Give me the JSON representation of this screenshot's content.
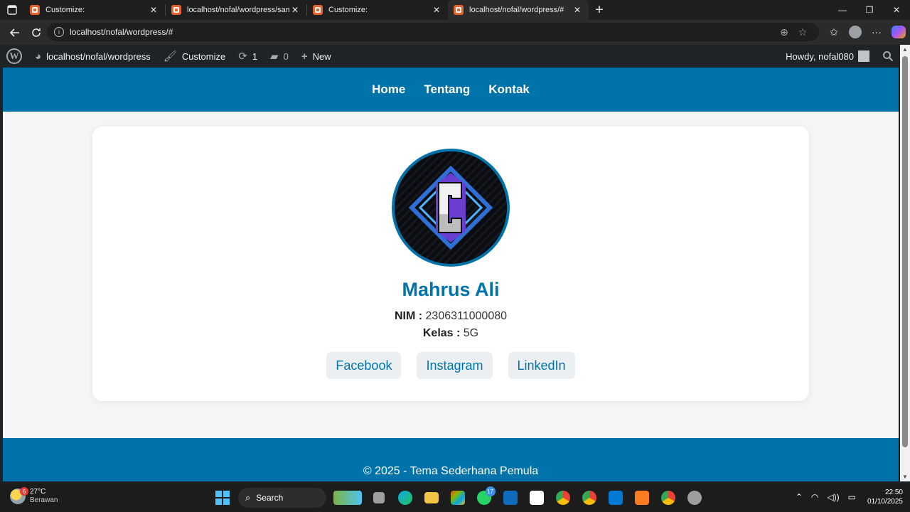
{
  "browser": {
    "tabs": [
      {
        "title": "Customize:",
        "active": false
      },
      {
        "title": "localhost/nofal/wordpress/sample-page/",
        "active": false
      },
      {
        "title": "Customize:",
        "active": false
      },
      {
        "title": "localhost/nofal/wordpress/#",
        "active": true
      }
    ],
    "new_tab_label": "+",
    "url": "localhost/nofal/wordpress/#"
  },
  "admin_bar": {
    "site_name": "localhost/nofal/wordpress",
    "customize_label": "Customize",
    "updates_count": "1",
    "comments_count": "0",
    "new_label": "New",
    "howdy": "Howdy, nofal080"
  },
  "site": {
    "nav": [
      "Home",
      "Tentang",
      "Kontak"
    ],
    "profile": {
      "name": "Mahrus Ali",
      "nim_label": "NIM :",
      "nim_value": "2306311000080",
      "kelas_label": "Kelas :",
      "kelas_value": "5G"
    },
    "social": [
      "Facebook",
      "Instagram",
      "LinkedIn"
    ],
    "footer": "© 2025 - Tema Sederhana Pemula"
  },
  "taskbar": {
    "weather_temp": "27°C",
    "weather_cond": "Berawan",
    "weather_badge": "6",
    "search_label": "Search",
    "whatsapp_badge": "17",
    "time": "22:50",
    "date": "01/10/2025"
  },
  "colors": {
    "accent": "#0073aa",
    "admin_bar": "#1d2327",
    "page_bg": "#f4f5f7"
  }
}
